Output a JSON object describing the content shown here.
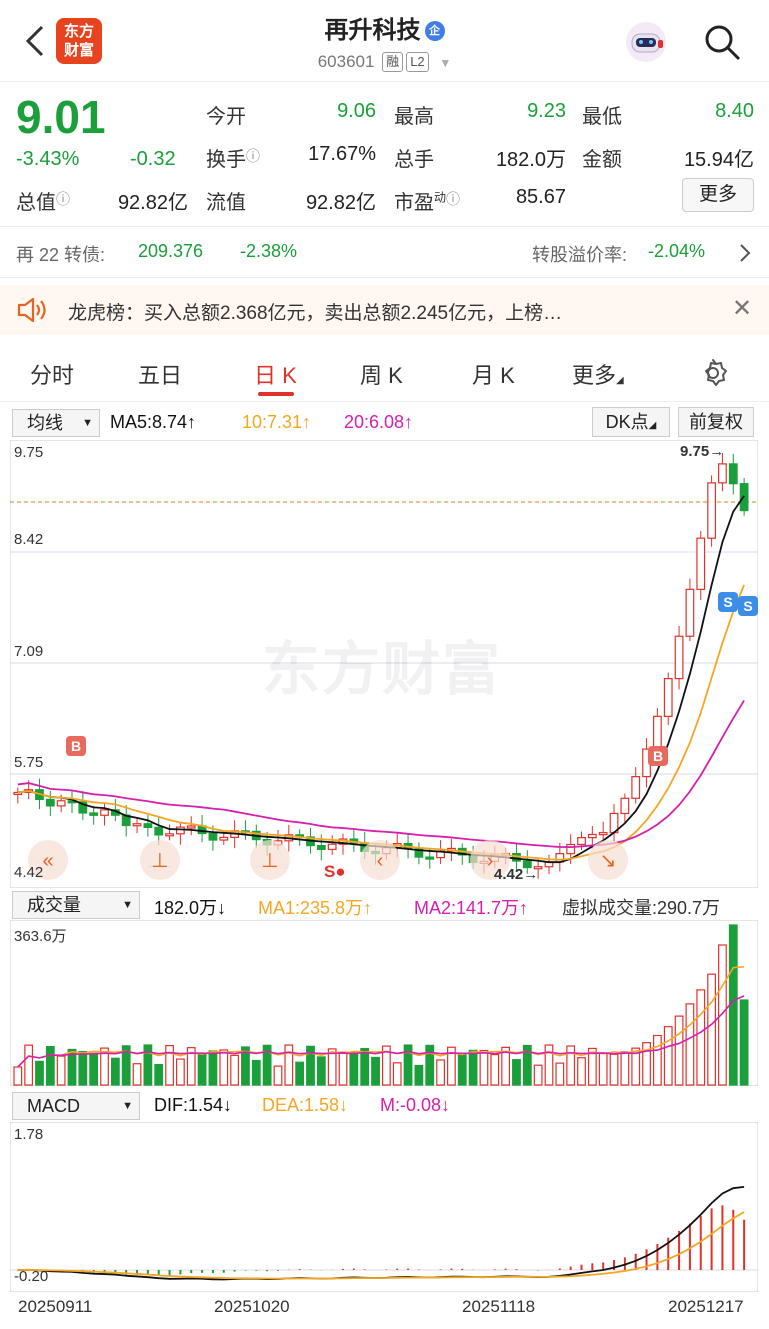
{
  "header": {
    "logo_text": "东方\n财富",
    "title": "再升科技",
    "title_badge": "企",
    "code": "603601",
    "tag_rong": "融",
    "tag_l2": "L2"
  },
  "quote": {
    "price": "9.01",
    "change_pct": "-3.43%",
    "change": "-0.32",
    "open_label": "今开",
    "open": "9.06",
    "high_label": "最高",
    "high": "9.23",
    "low_label": "最低",
    "low": "8.40",
    "turnover_label": "换手",
    "turnover": "17.67%",
    "volume_label": "总手",
    "volume": "182.0万",
    "amount_label": "金额",
    "amount": "15.94亿",
    "mktcap_label": "总值",
    "mktcap": "92.82亿",
    "float_label": "流值",
    "float": "92.82亿",
    "pe_label": "市盈",
    "pe_sup": "动",
    "pe": "85.67",
    "more_label": "更多"
  },
  "bond": {
    "name": "再 22 转债:",
    "price": "209.376",
    "change": "-2.38%",
    "premium_label": "转股溢价率:",
    "premium": "-2.04%"
  },
  "notice": {
    "text": "龙虎榜：买入总额2.368亿元，卖出总额2.245亿元，上榜…"
  },
  "tabs": [
    "分时",
    "五日",
    "日 K",
    "周 K",
    "月 K",
    "更多"
  ],
  "active_tab": "日 K",
  "kline": {
    "selector": "均线",
    "ma5": "MA5:8.74↑",
    "ma10": "10:7.31↑",
    "ma20": "20:6.08↑",
    "dk_label": "DK点",
    "adjust_label": "前复权",
    "y_labels": [
      "9.75",
      "8.42",
      "7.09",
      "5.75",
      "4.42"
    ],
    "high_mark": "9.75→",
    "low_mark": "4.42→",
    "watermark": "东方财富",
    "buy_mark": "B",
    "sell_mark": "S",
    "so_mark": "S●",
    "ylim": [
      4.42,
      9.75
    ]
  },
  "volume": {
    "selector": "成交量",
    "value": "182.0万↓",
    "ma1": "MA1:235.8万↑",
    "ma2": "MA2:141.7万↑",
    "virtual": "虚拟成交量:290.7万",
    "max_label": "363.6万"
  },
  "macd": {
    "selector": "MACD",
    "dif": "DIF:1.54↓",
    "dea": "DEA:1.58↓",
    "m": "M:-0.08↓",
    "top_label": "1.78",
    "bottom_label": "-0.20"
  },
  "dates": [
    "20250911",
    "20251020",
    "20251118",
    "20251217"
  ],
  "colors": {
    "up": "#e0322b",
    "down": "#1a9f3a",
    "ma5": "#111111",
    "ma10": "#f5a623",
    "ma20": "#d61fae"
  }
}
